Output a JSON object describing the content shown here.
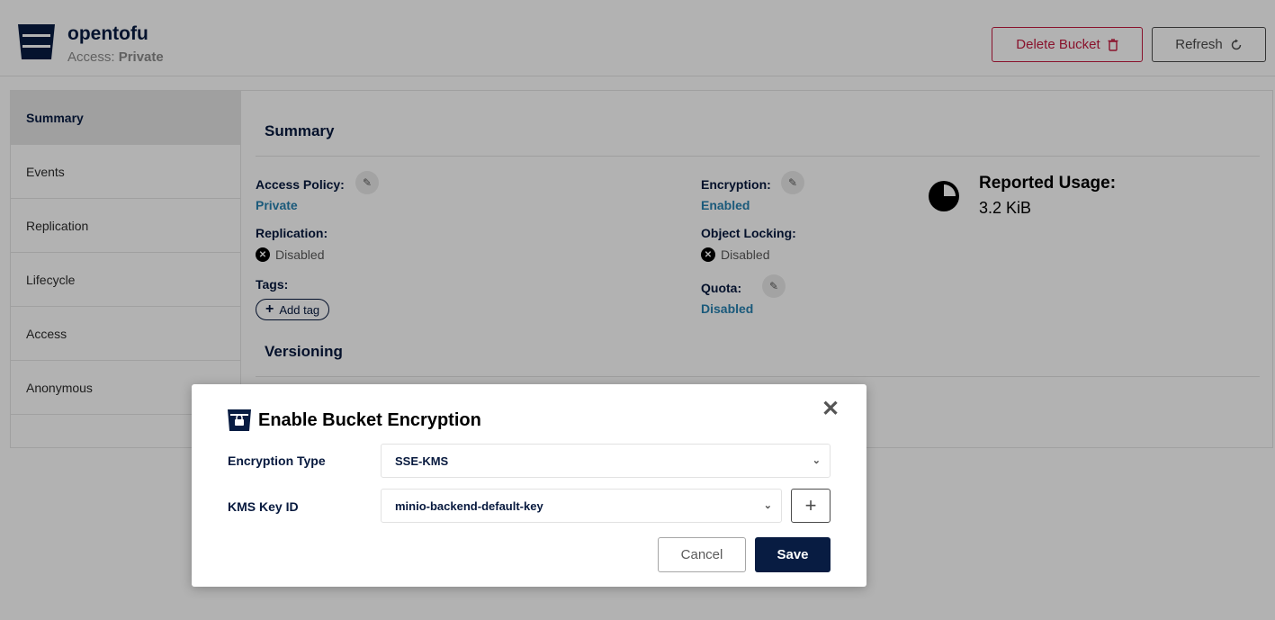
{
  "header": {
    "bucket_name": "opentofu",
    "access_label": "Access:",
    "access_value": "Private",
    "delete_button": "Delete Bucket",
    "refresh_button": "Refresh"
  },
  "sidebar": {
    "items": [
      {
        "label": "Summary",
        "active": true
      },
      {
        "label": "Events"
      },
      {
        "label": "Replication"
      },
      {
        "label": "Lifecycle"
      },
      {
        "label": "Access"
      },
      {
        "label": "Anonymous"
      }
    ]
  },
  "summary": {
    "title": "Summary",
    "access_policy_label": "Access Policy:",
    "access_policy_value": "Private",
    "replication_label": "Replication:",
    "replication_value": "Disabled",
    "tags_label": "Tags:",
    "add_tag": "Add tag",
    "encryption_label": "Encryption:",
    "encryption_value": "Enabled",
    "object_locking_label": "Object Locking:",
    "object_locking_value": "Disabled",
    "quota_label": "Quota:",
    "quota_value": "Disabled",
    "usage_title": "Reported Usage:",
    "usage_value": "3.2 KiB",
    "versioning_title": "Versioning"
  },
  "modal": {
    "title": "Enable Bucket Encryption",
    "encryption_type_label": "Encryption Type",
    "encryption_type_value": "SSE-KMS",
    "kms_key_label": "KMS Key ID",
    "kms_key_value": "minio-backend-default-key",
    "cancel": "Cancel",
    "save": "Save"
  },
  "colors": {
    "primary": "#081c42",
    "danger": "#c51b3f",
    "link": "#2781b0"
  }
}
